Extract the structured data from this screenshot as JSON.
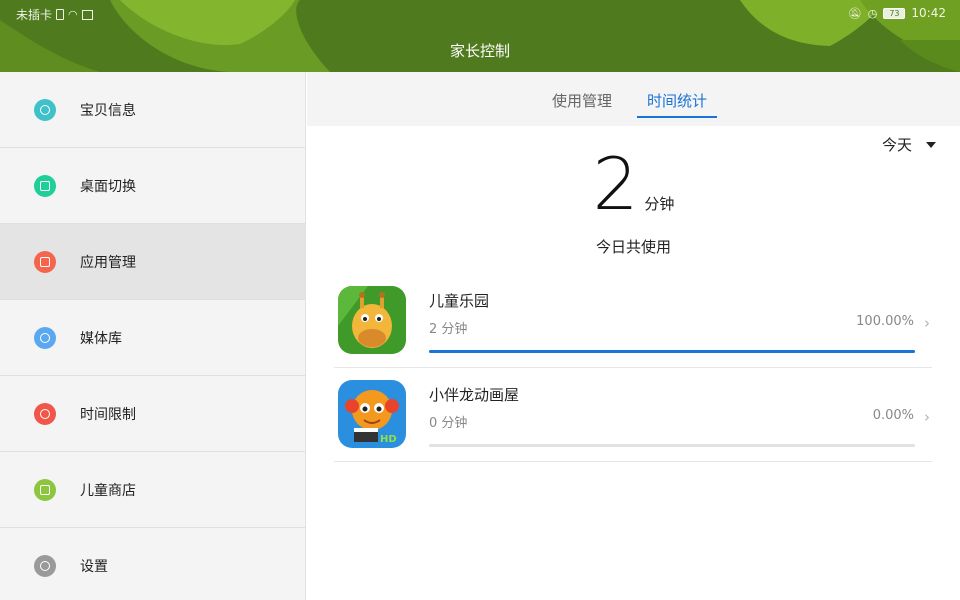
{
  "status_bar": {
    "carrier": "未插卡",
    "battery": "73",
    "time": "10:42"
  },
  "header": {
    "title": "家长控制",
    "bg_color": "#4f7a1e"
  },
  "sidebar": {
    "items": [
      {
        "label": "宝贝信息",
        "icon": "baby-info-icon",
        "color": "#3fc1c9"
      },
      {
        "label": "桌面切换",
        "icon": "desktop-switch-icon",
        "color": "#1fcf9a"
      },
      {
        "label": "应用管理",
        "icon": "app-grid-icon",
        "color": "#f5654e",
        "active": true
      },
      {
        "label": "媒体库",
        "icon": "media-library-icon",
        "color": "#5aa9f0"
      },
      {
        "label": "时间限制",
        "icon": "clock-icon",
        "color": "#f0574a"
      },
      {
        "label": "儿童商店",
        "icon": "store-bag-icon",
        "color": "#8cc63e"
      },
      {
        "label": "设置",
        "icon": "gear-icon",
        "color": "#9a9a9a"
      }
    ]
  },
  "main": {
    "tabs": [
      {
        "label": "使用管理",
        "active": false
      },
      {
        "label": "时间统计",
        "active": true
      }
    ],
    "period": "今天",
    "total": {
      "value": "2",
      "unit": "分钟",
      "caption": "今日共使用"
    },
    "apps": [
      {
        "name": "儿童乐园",
        "time": "2 分钟",
        "percent": "100.00%",
        "progress": 1.0,
        "icon": "giraffe-app-icon"
      },
      {
        "name": "小伴龙动画屋",
        "time": "0 分钟",
        "percent": "0.00%",
        "progress": 0.0,
        "icon": "dragon-app-icon"
      }
    ],
    "accent_color": "#1a73d6"
  }
}
